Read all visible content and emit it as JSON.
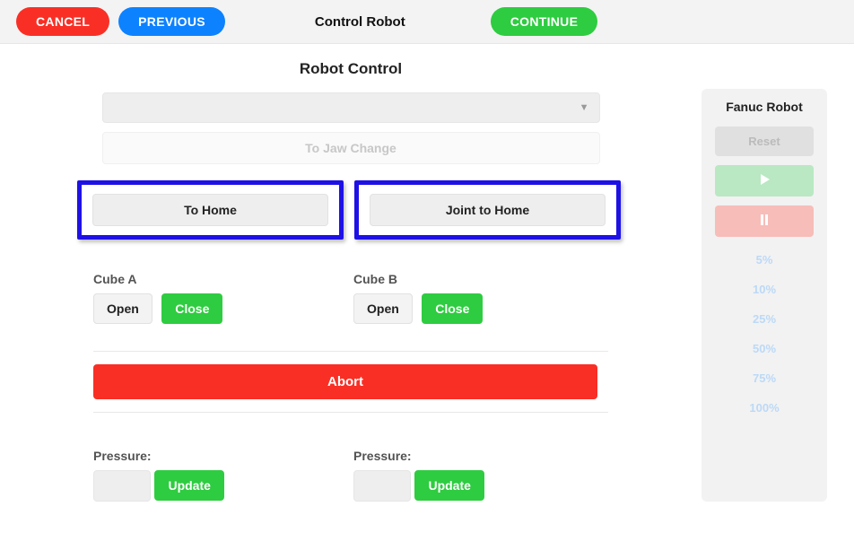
{
  "topbar": {
    "cancel": "CANCEL",
    "previous": "PREVIOUS",
    "title": "Control Robot",
    "continue": "CONTINUE"
  },
  "main": {
    "heading": "Robot Control",
    "jaw_change": "To Jaw Change",
    "to_home": "To Home",
    "joint_to_home": "Joint to Home",
    "cube_a_label": "Cube A",
    "cube_b_label": "Cube B",
    "open": "Open",
    "close": "Close",
    "abort": "Abort",
    "pressure_label": "Pressure:",
    "update": "Update"
  },
  "sidebar": {
    "title": "Fanuc Robot",
    "reset": "Reset",
    "speeds": [
      "5%",
      "10%",
      "25%",
      "50%",
      "75%",
      "100%"
    ]
  }
}
